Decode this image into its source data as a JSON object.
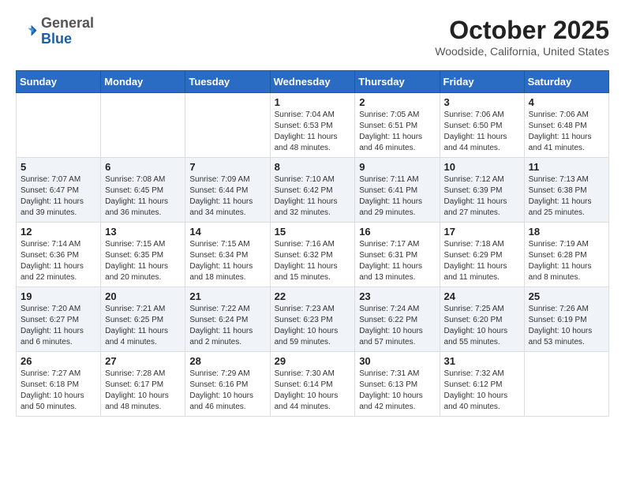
{
  "header": {
    "logo_general": "General",
    "logo_blue": "Blue",
    "month_title": "October 2025",
    "location": "Woodside, California, United States"
  },
  "days_of_week": [
    "Sunday",
    "Monday",
    "Tuesday",
    "Wednesday",
    "Thursday",
    "Friday",
    "Saturday"
  ],
  "weeks": [
    [
      {
        "day": "",
        "info": ""
      },
      {
        "day": "",
        "info": ""
      },
      {
        "day": "",
        "info": ""
      },
      {
        "day": "1",
        "info": "Sunrise: 7:04 AM\nSunset: 6:53 PM\nDaylight: 11 hours\nand 48 minutes."
      },
      {
        "day": "2",
        "info": "Sunrise: 7:05 AM\nSunset: 6:51 PM\nDaylight: 11 hours\nand 46 minutes."
      },
      {
        "day": "3",
        "info": "Sunrise: 7:06 AM\nSunset: 6:50 PM\nDaylight: 11 hours\nand 44 minutes."
      },
      {
        "day": "4",
        "info": "Sunrise: 7:06 AM\nSunset: 6:48 PM\nDaylight: 11 hours\nand 41 minutes."
      }
    ],
    [
      {
        "day": "5",
        "info": "Sunrise: 7:07 AM\nSunset: 6:47 PM\nDaylight: 11 hours\nand 39 minutes."
      },
      {
        "day": "6",
        "info": "Sunrise: 7:08 AM\nSunset: 6:45 PM\nDaylight: 11 hours\nand 36 minutes."
      },
      {
        "day": "7",
        "info": "Sunrise: 7:09 AM\nSunset: 6:44 PM\nDaylight: 11 hours\nand 34 minutes."
      },
      {
        "day": "8",
        "info": "Sunrise: 7:10 AM\nSunset: 6:42 PM\nDaylight: 11 hours\nand 32 minutes."
      },
      {
        "day": "9",
        "info": "Sunrise: 7:11 AM\nSunset: 6:41 PM\nDaylight: 11 hours\nand 29 minutes."
      },
      {
        "day": "10",
        "info": "Sunrise: 7:12 AM\nSunset: 6:39 PM\nDaylight: 11 hours\nand 27 minutes."
      },
      {
        "day": "11",
        "info": "Sunrise: 7:13 AM\nSunset: 6:38 PM\nDaylight: 11 hours\nand 25 minutes."
      }
    ],
    [
      {
        "day": "12",
        "info": "Sunrise: 7:14 AM\nSunset: 6:36 PM\nDaylight: 11 hours\nand 22 minutes."
      },
      {
        "day": "13",
        "info": "Sunrise: 7:15 AM\nSunset: 6:35 PM\nDaylight: 11 hours\nand 20 minutes."
      },
      {
        "day": "14",
        "info": "Sunrise: 7:15 AM\nSunset: 6:34 PM\nDaylight: 11 hours\nand 18 minutes."
      },
      {
        "day": "15",
        "info": "Sunrise: 7:16 AM\nSunset: 6:32 PM\nDaylight: 11 hours\nand 15 minutes."
      },
      {
        "day": "16",
        "info": "Sunrise: 7:17 AM\nSunset: 6:31 PM\nDaylight: 11 hours\nand 13 minutes."
      },
      {
        "day": "17",
        "info": "Sunrise: 7:18 AM\nSunset: 6:29 PM\nDaylight: 11 hours\nand 11 minutes."
      },
      {
        "day": "18",
        "info": "Sunrise: 7:19 AM\nSunset: 6:28 PM\nDaylight: 11 hours\nand 8 minutes."
      }
    ],
    [
      {
        "day": "19",
        "info": "Sunrise: 7:20 AM\nSunset: 6:27 PM\nDaylight: 11 hours\nand 6 minutes."
      },
      {
        "day": "20",
        "info": "Sunrise: 7:21 AM\nSunset: 6:25 PM\nDaylight: 11 hours\nand 4 minutes."
      },
      {
        "day": "21",
        "info": "Sunrise: 7:22 AM\nSunset: 6:24 PM\nDaylight: 11 hours\nand 2 minutes."
      },
      {
        "day": "22",
        "info": "Sunrise: 7:23 AM\nSunset: 6:23 PM\nDaylight: 10 hours\nand 59 minutes."
      },
      {
        "day": "23",
        "info": "Sunrise: 7:24 AM\nSunset: 6:22 PM\nDaylight: 10 hours\nand 57 minutes."
      },
      {
        "day": "24",
        "info": "Sunrise: 7:25 AM\nSunset: 6:20 PM\nDaylight: 10 hours\nand 55 minutes."
      },
      {
        "day": "25",
        "info": "Sunrise: 7:26 AM\nSunset: 6:19 PM\nDaylight: 10 hours\nand 53 minutes."
      }
    ],
    [
      {
        "day": "26",
        "info": "Sunrise: 7:27 AM\nSunset: 6:18 PM\nDaylight: 10 hours\nand 50 minutes."
      },
      {
        "day": "27",
        "info": "Sunrise: 7:28 AM\nSunset: 6:17 PM\nDaylight: 10 hours\nand 48 minutes."
      },
      {
        "day": "28",
        "info": "Sunrise: 7:29 AM\nSunset: 6:16 PM\nDaylight: 10 hours\nand 46 minutes."
      },
      {
        "day": "29",
        "info": "Sunrise: 7:30 AM\nSunset: 6:14 PM\nDaylight: 10 hours\nand 44 minutes."
      },
      {
        "day": "30",
        "info": "Sunrise: 7:31 AM\nSunset: 6:13 PM\nDaylight: 10 hours\nand 42 minutes."
      },
      {
        "day": "31",
        "info": "Sunrise: 7:32 AM\nSunset: 6:12 PM\nDaylight: 10 hours\nand 40 minutes."
      },
      {
        "day": "",
        "info": ""
      }
    ]
  ]
}
